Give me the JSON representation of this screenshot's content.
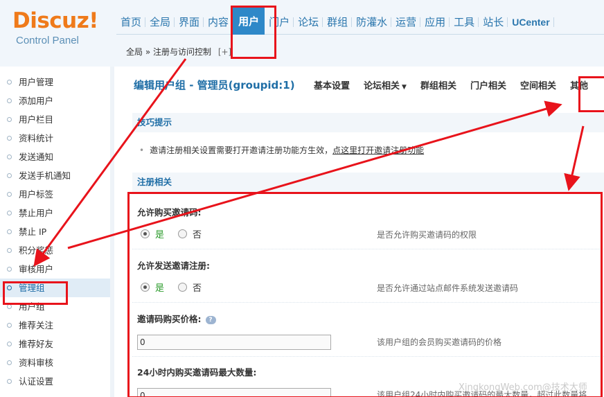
{
  "logo": {
    "name": "Discuz!",
    "subtitle": "Control Panel"
  },
  "nav": {
    "items": [
      "首页",
      "全局",
      "界面",
      "内容",
      "用户",
      "门户",
      "论坛",
      "群组",
      "防灌水",
      "运营",
      "应用",
      "工具",
      "站长",
      "UCenter"
    ],
    "active": "用户"
  },
  "breadcrumb": {
    "text": "全局 » 注册与访问控制",
    "add": "[+]"
  },
  "sidebar": {
    "items": [
      "用户管理",
      "添加用户",
      "用户栏目",
      "资料统计",
      "发送通知",
      "发送手机通知",
      "用户标签",
      "禁止用户",
      "禁止 IP",
      "积分奖惩",
      "审核用户",
      "管理组",
      "用户组",
      "推荐关注",
      "推荐好友",
      "资料审核",
      "认证设置"
    ],
    "active": "管理组"
  },
  "main": {
    "title": "编辑用户组 - 管理员(groupid:1)",
    "tabs": [
      "基本设置",
      "论坛相关",
      "群组相关",
      "门户相关",
      "空间相关",
      "其他"
    ],
    "tip_section": "技巧提示",
    "tip_text": "邀请注册相关设置需要打开邀请注册功能方生效，",
    "tip_link": "点这里打开邀请注册功能",
    "reg_section": "注册相关",
    "settings": [
      {
        "label": "允许购买邀请码:",
        "yes": "是",
        "no": "否",
        "hint": "是否允许购买邀请码的权限"
      },
      {
        "label": "允许发送邀请注册:",
        "yes": "是",
        "no": "否",
        "hint": "是否允许通过站点邮件系统发送邀请码"
      },
      {
        "label": "邀请码购买价格:",
        "value": "0",
        "hint": "该用户组的会员购买邀请码的价格"
      },
      {
        "label": "24小时内购买邀请码最大数量:",
        "value": "0",
        "hint": "该用户组24小时内购买邀请码的最大数量，超过此数量将"
      }
    ]
  },
  "watermark": "XingkongWeb.com@技术大师",
  "colors": {
    "annotation": "#e8131b",
    "nav_active": "#2e88c8",
    "title": "#1f6ea6"
  }
}
